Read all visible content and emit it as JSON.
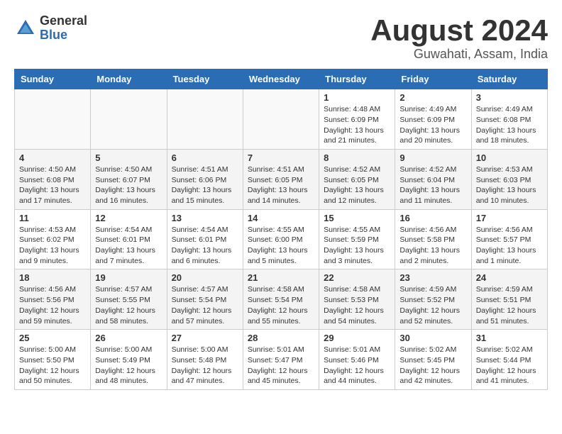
{
  "header": {
    "logo_general": "General",
    "logo_blue": "Blue",
    "month_year": "August 2024",
    "location": "Guwahati, Assam, India"
  },
  "days_of_week": [
    "Sunday",
    "Monday",
    "Tuesday",
    "Wednesday",
    "Thursday",
    "Friday",
    "Saturday"
  ],
  "weeks": [
    [
      {
        "day": "",
        "info": ""
      },
      {
        "day": "",
        "info": ""
      },
      {
        "day": "",
        "info": ""
      },
      {
        "day": "",
        "info": ""
      },
      {
        "day": "1",
        "info": "Sunrise: 4:48 AM\nSunset: 6:09 PM\nDaylight: 13 hours\nand 21 minutes."
      },
      {
        "day": "2",
        "info": "Sunrise: 4:49 AM\nSunset: 6:09 PM\nDaylight: 13 hours\nand 20 minutes."
      },
      {
        "day": "3",
        "info": "Sunrise: 4:49 AM\nSunset: 6:08 PM\nDaylight: 13 hours\nand 18 minutes."
      }
    ],
    [
      {
        "day": "4",
        "info": "Sunrise: 4:50 AM\nSunset: 6:08 PM\nDaylight: 13 hours\nand 17 minutes."
      },
      {
        "day": "5",
        "info": "Sunrise: 4:50 AM\nSunset: 6:07 PM\nDaylight: 13 hours\nand 16 minutes."
      },
      {
        "day": "6",
        "info": "Sunrise: 4:51 AM\nSunset: 6:06 PM\nDaylight: 13 hours\nand 15 minutes."
      },
      {
        "day": "7",
        "info": "Sunrise: 4:51 AM\nSunset: 6:05 PM\nDaylight: 13 hours\nand 14 minutes."
      },
      {
        "day": "8",
        "info": "Sunrise: 4:52 AM\nSunset: 6:05 PM\nDaylight: 13 hours\nand 12 minutes."
      },
      {
        "day": "9",
        "info": "Sunrise: 4:52 AM\nSunset: 6:04 PM\nDaylight: 13 hours\nand 11 minutes."
      },
      {
        "day": "10",
        "info": "Sunrise: 4:53 AM\nSunset: 6:03 PM\nDaylight: 13 hours\nand 10 minutes."
      }
    ],
    [
      {
        "day": "11",
        "info": "Sunrise: 4:53 AM\nSunset: 6:02 PM\nDaylight: 13 hours\nand 9 minutes."
      },
      {
        "day": "12",
        "info": "Sunrise: 4:54 AM\nSunset: 6:01 PM\nDaylight: 13 hours\nand 7 minutes."
      },
      {
        "day": "13",
        "info": "Sunrise: 4:54 AM\nSunset: 6:01 PM\nDaylight: 13 hours\nand 6 minutes."
      },
      {
        "day": "14",
        "info": "Sunrise: 4:55 AM\nSunset: 6:00 PM\nDaylight: 13 hours\nand 5 minutes."
      },
      {
        "day": "15",
        "info": "Sunrise: 4:55 AM\nSunset: 5:59 PM\nDaylight: 13 hours\nand 3 minutes."
      },
      {
        "day": "16",
        "info": "Sunrise: 4:56 AM\nSunset: 5:58 PM\nDaylight: 13 hours\nand 2 minutes."
      },
      {
        "day": "17",
        "info": "Sunrise: 4:56 AM\nSunset: 5:57 PM\nDaylight: 13 hours\nand 1 minute."
      }
    ],
    [
      {
        "day": "18",
        "info": "Sunrise: 4:56 AM\nSunset: 5:56 PM\nDaylight: 12 hours\nand 59 minutes."
      },
      {
        "day": "19",
        "info": "Sunrise: 4:57 AM\nSunset: 5:55 PM\nDaylight: 12 hours\nand 58 minutes."
      },
      {
        "day": "20",
        "info": "Sunrise: 4:57 AM\nSunset: 5:54 PM\nDaylight: 12 hours\nand 57 minutes."
      },
      {
        "day": "21",
        "info": "Sunrise: 4:58 AM\nSunset: 5:54 PM\nDaylight: 12 hours\nand 55 minutes."
      },
      {
        "day": "22",
        "info": "Sunrise: 4:58 AM\nSunset: 5:53 PM\nDaylight: 12 hours\nand 54 minutes."
      },
      {
        "day": "23",
        "info": "Sunrise: 4:59 AM\nSunset: 5:52 PM\nDaylight: 12 hours\nand 52 minutes."
      },
      {
        "day": "24",
        "info": "Sunrise: 4:59 AM\nSunset: 5:51 PM\nDaylight: 12 hours\nand 51 minutes."
      }
    ],
    [
      {
        "day": "25",
        "info": "Sunrise: 5:00 AM\nSunset: 5:50 PM\nDaylight: 12 hours\nand 50 minutes."
      },
      {
        "day": "26",
        "info": "Sunrise: 5:00 AM\nSunset: 5:49 PM\nDaylight: 12 hours\nand 48 minutes."
      },
      {
        "day": "27",
        "info": "Sunrise: 5:00 AM\nSunset: 5:48 PM\nDaylight: 12 hours\nand 47 minutes."
      },
      {
        "day": "28",
        "info": "Sunrise: 5:01 AM\nSunset: 5:47 PM\nDaylight: 12 hours\nand 45 minutes."
      },
      {
        "day": "29",
        "info": "Sunrise: 5:01 AM\nSunset: 5:46 PM\nDaylight: 12 hours\nand 44 minutes."
      },
      {
        "day": "30",
        "info": "Sunrise: 5:02 AM\nSunset: 5:45 PM\nDaylight: 12 hours\nand 42 minutes."
      },
      {
        "day": "31",
        "info": "Sunrise: 5:02 AM\nSunset: 5:44 PM\nDaylight: 12 hours\nand 41 minutes."
      }
    ]
  ],
  "row_styles": [
    "row-white",
    "row-gray",
    "row-white",
    "row-gray",
    "row-white"
  ]
}
